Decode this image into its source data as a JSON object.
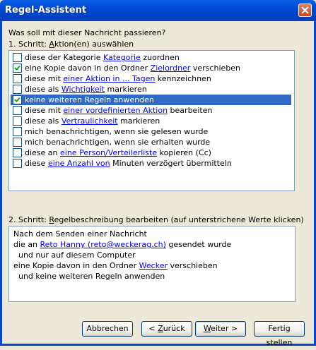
{
  "window": {
    "title": "Regel-Assistent"
  },
  "prompt": "Was soll mit dieser Nachricht passieren?",
  "step1": {
    "pre": "1. Schritt: ",
    "ul": "A",
    "post": "ktion(en) auswählen"
  },
  "actions": [
    {
      "checked": false,
      "selected": false,
      "parts": [
        {
          "t": "diese der Kategorie "
        },
        {
          "t": "Kategorie",
          "link": true
        },
        {
          "t": " zuordnen"
        }
      ]
    },
    {
      "checked": true,
      "selected": false,
      "parts": [
        {
          "t": "eine Kopie davon in den Ordner "
        },
        {
          "t": "Zielordner",
          "link": true
        },
        {
          "t": " verschieben"
        }
      ]
    },
    {
      "checked": false,
      "selected": false,
      "parts": [
        {
          "t": "diese mit "
        },
        {
          "t": "einer Aktion in ... Tagen",
          "link": true
        },
        {
          "t": " kennzeichnen"
        }
      ]
    },
    {
      "checked": false,
      "selected": false,
      "parts": [
        {
          "t": "diese als "
        },
        {
          "t": "Wichtigkeit",
          "link": true
        },
        {
          "t": " markieren"
        }
      ]
    },
    {
      "checked": true,
      "selected": true,
      "parts": [
        {
          "t": "keine weiteren Regeln anwenden"
        }
      ]
    },
    {
      "checked": false,
      "selected": false,
      "parts": [
        {
          "t": "diese mit "
        },
        {
          "t": "einer vordefinierten Aktion",
          "link": true
        },
        {
          "t": " bearbeiten"
        }
      ]
    },
    {
      "checked": false,
      "selected": false,
      "parts": [
        {
          "t": "diese als "
        },
        {
          "t": "Vertraulichkeit",
          "link": true
        },
        {
          "t": " markieren"
        }
      ]
    },
    {
      "checked": false,
      "selected": false,
      "parts": [
        {
          "t": "mich benachrichtigen, wenn sie gelesen wurde"
        }
      ]
    },
    {
      "checked": false,
      "selected": false,
      "parts": [
        {
          "t": "mich benachrichtigen, wenn sie erhalten wurde"
        }
      ]
    },
    {
      "checked": false,
      "selected": false,
      "parts": [
        {
          "t": "diese an "
        },
        {
          "t": "eine Person/Verteilerliste",
          "link": true
        },
        {
          "t": " kopieren (Cc)"
        }
      ]
    },
    {
      "checked": false,
      "selected": false,
      "parts": [
        {
          "t": "diese "
        },
        {
          "t": "eine Anzahl von",
          "link": true
        },
        {
          "t": " Minuten verzögert übermitteln"
        }
      ]
    }
  ],
  "step2": {
    "pre": "2. Schritt: ",
    "ul": "R",
    "post": "egelbeschreibung bearbeiten (auf unterstrichene Werte klicken)"
  },
  "description": [
    {
      "parts": [
        {
          "t": "Nach dem Senden einer Nachricht"
        }
      ]
    },
    {
      "parts": [
        {
          "t": "die an "
        },
        {
          "t": "Reto Hanny (reto@weckerag.ch)",
          "link": true
        },
        {
          "t": " gesendet wurde"
        }
      ]
    },
    {
      "parts": [
        {
          "t": "  und nur auf diesem Computer"
        }
      ]
    },
    {
      "parts": [
        {
          "t": "eine Kopie davon in den Ordner "
        },
        {
          "t": "Wecker",
          "link": true
        },
        {
          "t": " verschieben"
        }
      ]
    },
    {
      "parts": [
        {
          "t": "  und keine weiteren Regeln anwenden"
        }
      ]
    }
  ],
  "buttons": {
    "cancel": "Abbrechen",
    "back": {
      "pre": "< ",
      "ul": "Z",
      "post": "urück"
    },
    "next": {
      "pre": "",
      "ul": "W",
      "post": "eiter >"
    },
    "finish": "Fertig stellen"
  },
  "colors": {
    "title_bar": "#0054E3",
    "selection": "#316AC5",
    "link": "#0000FF",
    "dialog_bg": "#ECE9D8"
  }
}
